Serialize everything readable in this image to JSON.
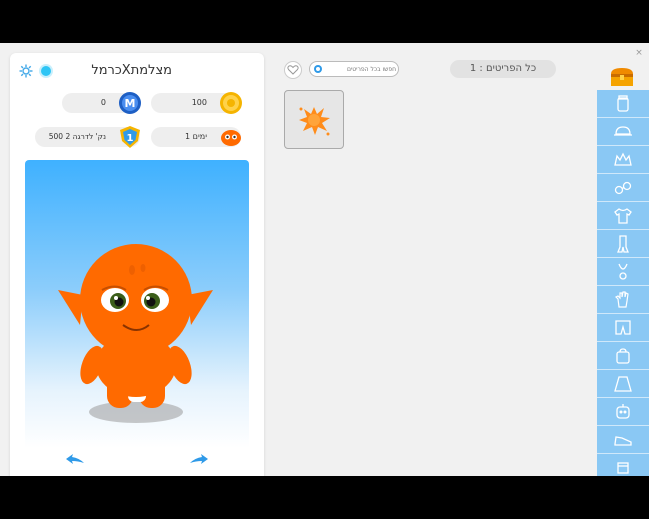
{
  "profile": {
    "username": "מצלמתXכרמל",
    "coins": "100",
    "mcoins": "0",
    "days": "1 ימים",
    "level_progress": "500 נק' לדרגה 2",
    "level_badge": "1",
    "mcoin_letter": "M"
  },
  "search": {
    "placeholder": "חפשו בכל הפריטים"
  },
  "items_count_label": "כל הפריטים : 1",
  "close_label": "×",
  "categories": [
    {
      "name": "jar-icon"
    },
    {
      "name": "cap-icon"
    },
    {
      "name": "hair-icon"
    },
    {
      "name": "glasses-icon"
    },
    {
      "name": "shirt-icon"
    },
    {
      "name": "scarf-icon"
    },
    {
      "name": "necklace-icon"
    },
    {
      "name": "glove-icon"
    },
    {
      "name": "shorts-icon"
    },
    {
      "name": "bag-icon"
    },
    {
      "name": "skirt-icon"
    },
    {
      "name": "robot-icon"
    },
    {
      "name": "shoe-icon"
    },
    {
      "name": "box-icon"
    }
  ],
  "colors": {
    "sidebar": "#8ac8f4",
    "character": "#ff6a00",
    "stage_top": "#3fb1ff"
  }
}
